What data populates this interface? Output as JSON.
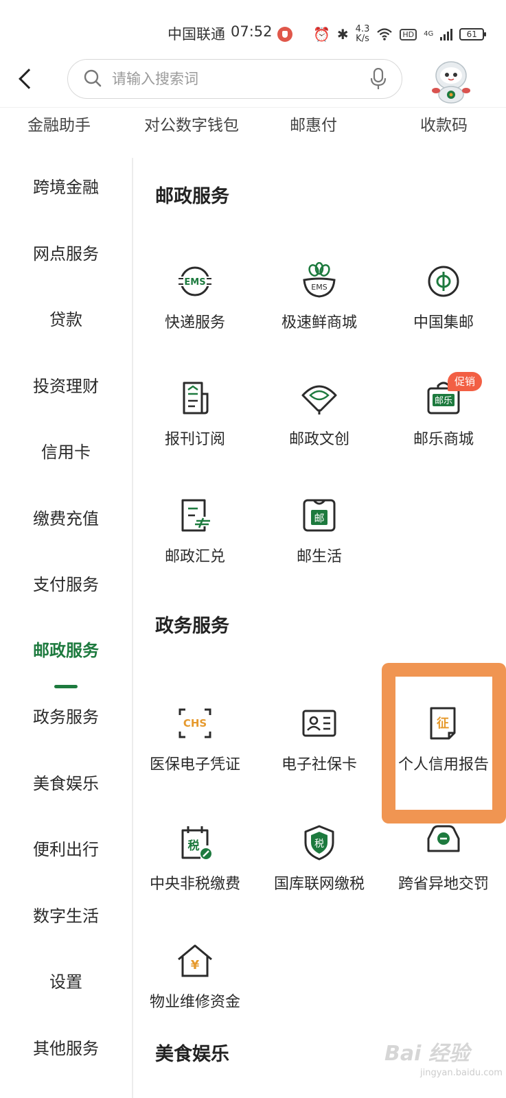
{
  "status_bar": {
    "carrier": "中国联通",
    "time": "07:52",
    "speed_value": "4.3",
    "speed_unit": "K/s",
    "hd": "HD",
    "network": "4G",
    "battery": "61"
  },
  "header": {
    "search_placeholder": "请输入搜索词"
  },
  "scrolled_row": [
    "金融助手",
    "对公数字钱包",
    "邮惠付",
    "收款码"
  ],
  "sidebar": {
    "items": [
      {
        "label": "跨境金融"
      },
      {
        "label": "网点服务"
      },
      {
        "label": "贷款"
      },
      {
        "label": "投资理财"
      },
      {
        "label": "信用卡"
      },
      {
        "label": "缴费充值"
      },
      {
        "label": "支付服务"
      },
      {
        "label": "邮政服务",
        "active": true
      },
      {
        "label": "政务服务"
      },
      {
        "label": "美食娱乐"
      },
      {
        "label": "便利出行"
      },
      {
        "label": "数字生活"
      },
      {
        "label": "设置"
      },
      {
        "label": "其他服务"
      }
    ]
  },
  "sections": {
    "postal": {
      "title": "邮政服务",
      "tiles": [
        {
          "label": "快递服务",
          "icon": "ems-icon"
        },
        {
          "label": "极速鲜商城",
          "icon": "ems-flower-icon"
        },
        {
          "label": "中国集邮",
          "icon": "stamp-coin-icon"
        },
        {
          "label": "报刊订阅",
          "icon": "newspaper-icon"
        },
        {
          "label": "邮政文创",
          "icon": "fan-icon"
        },
        {
          "label": "邮乐商城",
          "icon": "shopping-bag-icon",
          "badge": "促销"
        },
        {
          "label": "邮政汇兑",
          "icon": "remittance-icon"
        },
        {
          "label": "邮生活",
          "icon": "life-bag-icon"
        }
      ]
    },
    "government": {
      "title": "政务服务",
      "tiles": [
        {
          "label": "医保电子凭证",
          "icon": "chs-icon"
        },
        {
          "label": "电子社保卡",
          "icon": "id-card-icon"
        },
        {
          "label": "个人信用报告",
          "icon": "credit-report-icon"
        },
        {
          "label": "中央非税缴费",
          "icon": "tax-calendar-icon"
        },
        {
          "label": "国库联网缴税",
          "icon": "tax-shield-icon"
        },
        {
          "label": "跨省异地交罚",
          "icon": "car-fine-icon"
        },
        {
          "label": "物业维修资金",
          "icon": "house-yuan-icon"
        }
      ]
    },
    "food": {
      "title": "美食娱乐"
    }
  },
  "icon_text": {
    "ems": "EMS",
    "chs": "CHS",
    "tax": "税",
    "zheng": "征",
    "you": "邮",
    "youle": "邮乐",
    "yuan": "¥"
  },
  "watermark": {
    "brand": "Bai 经验",
    "url": "jingyan.baidu.com"
  },
  "colors": {
    "brand_green": "#1d7a3e",
    "highlight_orange": "#f09552",
    "promo_red": "#f25f44",
    "accent_orange": "#e69a2e"
  }
}
